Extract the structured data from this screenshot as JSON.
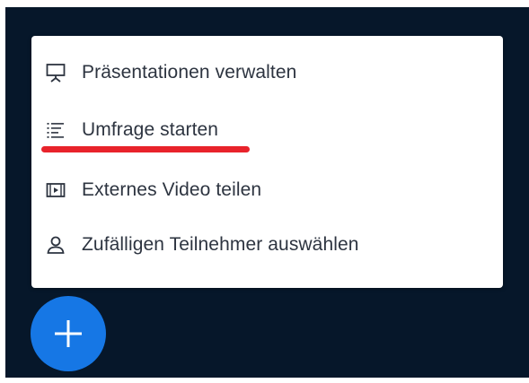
{
  "menu": {
    "items": [
      {
        "label": "Präsentationen verwalten",
        "icon": "presentation-icon"
      },
      {
        "label": "Umfrage starten",
        "icon": "poll-list-icon",
        "highlighted": true
      },
      {
        "label": "Externes Video teilen",
        "icon": "video-icon"
      },
      {
        "label": "Zufälligen Teilnehmer auswählen",
        "icon": "user-icon"
      }
    ]
  },
  "fab": {
    "icon": "plus-icon"
  },
  "colors": {
    "background": "#06172a",
    "menu_background": "#ffffff",
    "text": "#2d3440",
    "highlight_underline": "#e8232b",
    "fab": "#1677e5"
  }
}
